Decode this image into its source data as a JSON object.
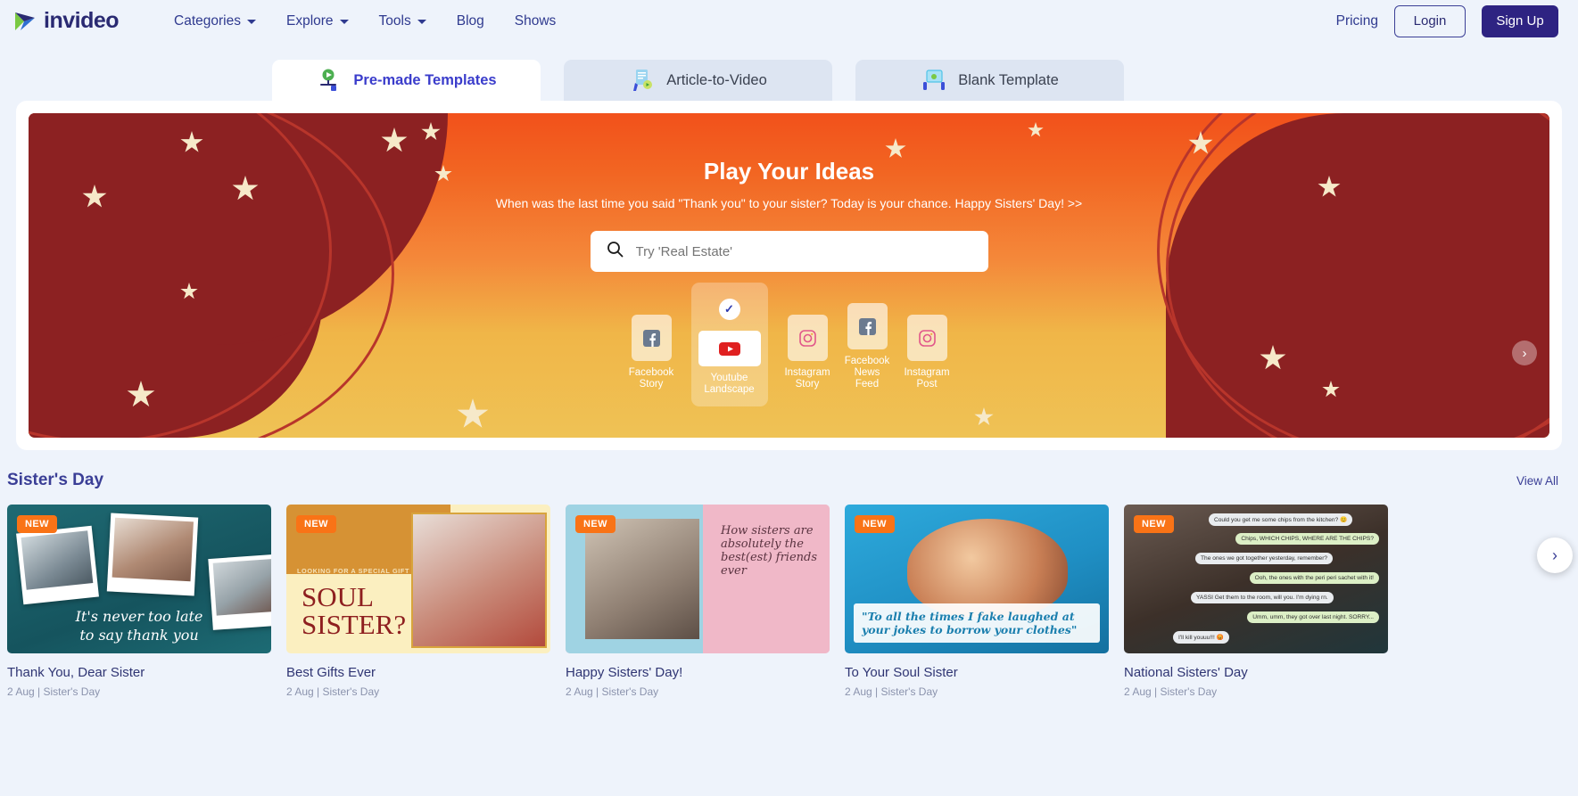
{
  "brand": {
    "name": "invideo",
    "logo_icon": "invideo-play-logo"
  },
  "nav": {
    "items": [
      {
        "label": "Categories",
        "has_dropdown": true
      },
      {
        "label": "Explore",
        "has_dropdown": true
      },
      {
        "label": "Tools",
        "has_dropdown": true
      },
      {
        "label": "Blog",
        "has_dropdown": false
      },
      {
        "label": "Shows",
        "has_dropdown": false
      }
    ],
    "pricing": "Pricing",
    "login": "Login",
    "signup": "Sign Up"
  },
  "tabs": [
    {
      "label": "Pre-made Templates",
      "icon": "video-template-icon",
      "active": true
    },
    {
      "label": "Article-to-Video",
      "icon": "article-document-icon",
      "active": false
    },
    {
      "label": "Blank Template",
      "icon": "blank-canvas-icon",
      "active": false
    }
  ],
  "hero": {
    "title": "Play Your Ideas",
    "subtitle": "When was the last time you said \"Thank you\" to your sister? Today is your chance. Happy Sisters' Day! >>",
    "search_placeholder": "Try 'Real Estate'",
    "search_value": "",
    "search_icon": "search-icon",
    "next_arrow": "›",
    "formats": [
      {
        "label": "Facebook\nStory",
        "icon": "facebook-icon",
        "selected": false
      },
      {
        "label": "Youtube\nLandscape",
        "icon": "youtube-icon",
        "selected": true
      },
      {
        "label": "Instagram\nStory",
        "icon": "instagram-icon",
        "selected": false
      },
      {
        "label": "Facebook\nNews Feed",
        "icon": "facebook-icon",
        "selected": false
      },
      {
        "label": "Instagram\nPost",
        "icon": "instagram-icon",
        "selected": false
      }
    ],
    "check_glyph": "✓"
  },
  "section": {
    "title": "Sister's Day",
    "view_all": "View All",
    "next_arrow": "›"
  },
  "cards": [
    {
      "title": "Thank You, Dear Sister",
      "meta": "2 Aug | Sister's Day",
      "badge": "NEW",
      "art_text_1": "It's never too late",
      "art_text_2": "to say thank you"
    },
    {
      "title": "Best Gifts Ever",
      "meta": "2 Aug | Sister's Day",
      "badge": "NEW",
      "art_kicker": "LOOKING FOR A SPECIAL GIFT FOR YOUR",
      "art_big_1": "SOUL",
      "art_big_2": "SISTER?"
    },
    {
      "title": "Happy Sisters' Day!",
      "meta": "2 Aug | Sister's Day",
      "badge": "NEW",
      "art_text": "How sisters are absolutely the best(est) friends ever"
    },
    {
      "title": "To Your Soul Sister",
      "meta": "2 Aug | Sister's Day",
      "badge": "NEW",
      "art_line_1": "\"To all the times I fake laughed at",
      "art_line_2": "your jokes to borrow your clothes\""
    },
    {
      "title": "National Sisters' Day",
      "meta": "2 Aug | Sister's Day",
      "badge": "NEW",
      "bubbles": [
        "Could you get me some chips from the kitchen? 😊",
        "Chips, WHICH CHIPS, WHERE ARE THE CHIPS?",
        "The ones we got together yesterday, remember?",
        "Ooh, the ones with the peri peri sachet with it!",
        "YASSI Get them to the room, will you. I'm dying rn.",
        "Umm, umm, they got over last night. SORRY...",
        "I'll kill youuu!!! 😡"
      ]
    }
  ],
  "colors": {
    "brand_blue": "#2a2a72",
    "accent_orange": "#f97316",
    "page_bg": "#eef3fb",
    "tab_active_text": "#3a3ccb"
  }
}
